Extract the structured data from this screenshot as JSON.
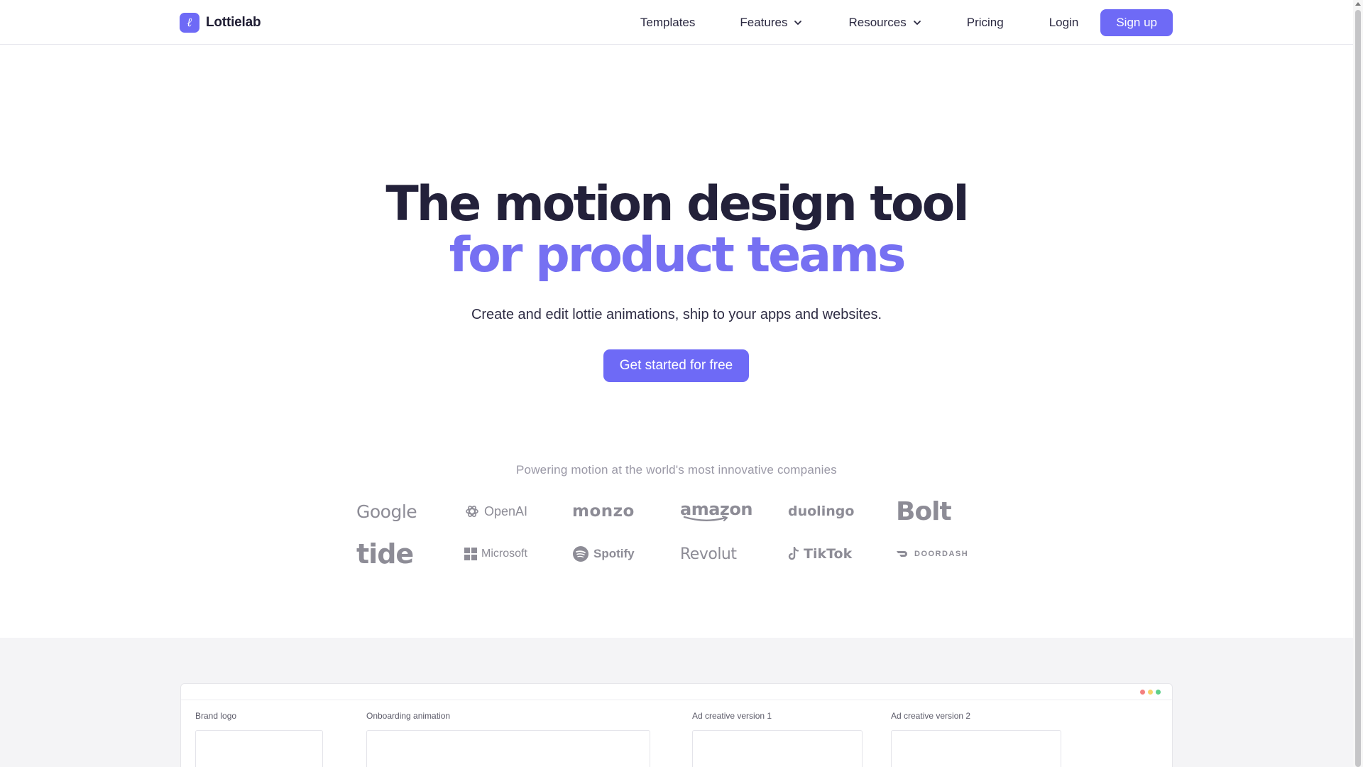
{
  "header": {
    "logo_text": "Lottielab",
    "logo_glyph": "ℓ",
    "nav": {
      "templates": "Templates",
      "features": "Features",
      "resources": "Resources",
      "pricing": "Pricing",
      "login": "Login",
      "signup": "Sign up"
    }
  },
  "hero": {
    "title_line1": "The motion design tool",
    "title_line2": "for product teams",
    "subtitle": "Create and edit lottie animations, ship to your apps and websites.",
    "cta": "Get started for free"
  },
  "trust": {
    "heading": "Powering motion at the world's most innovative companies",
    "logos": [
      "Google",
      "OpenAI",
      "monzo",
      "amazon",
      "duolingo",
      "Bolt",
      "tide",
      "Microsoft",
      "Spotify",
      "Revolut",
      "TikTok",
      "DOORDASH"
    ]
  },
  "showcase": {
    "cards": [
      "Brand logo",
      "Onboarding animation",
      "Ad creative version 1",
      "Ad creative version 2"
    ]
  },
  "colors": {
    "accent": "#6e6af6",
    "accent_text": "#7670f2",
    "title": "#23213a",
    "dot_red": "#f47f7f",
    "dot_yellow": "#f6d36b",
    "dot_green": "#5fd08a"
  },
  "icons": [
    "chevron-down-icon",
    "openai-icon",
    "microsoft-icon",
    "spotify-icon",
    "tiktok-icon",
    "doordash-icon"
  ]
}
